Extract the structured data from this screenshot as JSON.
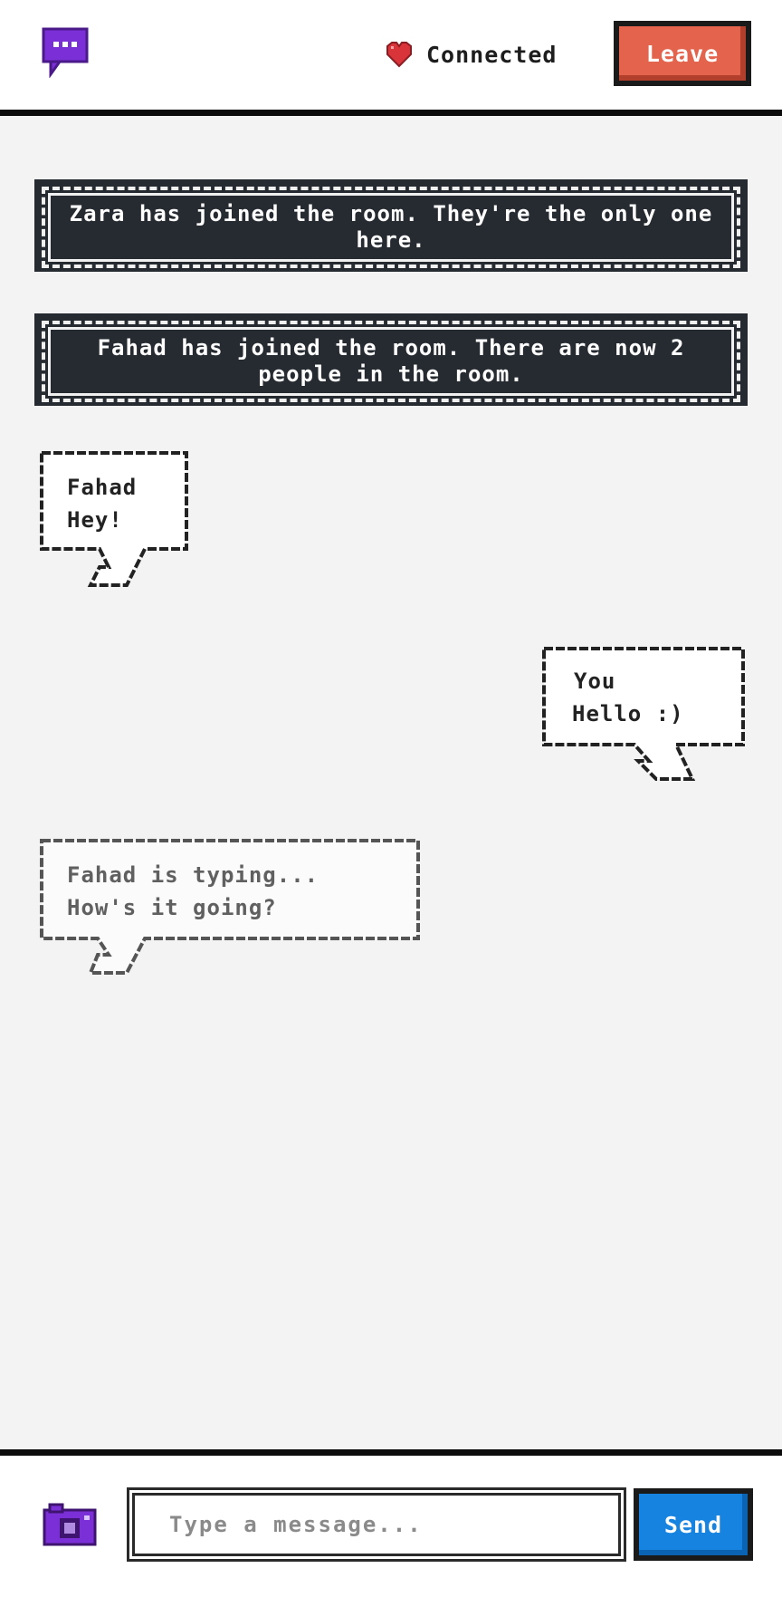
{
  "header": {
    "app_icon": "chat-bubble-icon",
    "status_icon": "heart-icon",
    "status_text": "Connected",
    "leave_label": "Leave"
  },
  "system_messages": [
    "Zara has joined the room. They're the only one here.",
    "Fahad has joined the room. There are now 2 people in the room."
  ],
  "messages": [
    {
      "author": "Fahad",
      "text": "Hey!"
    },
    {
      "author": "You",
      "text": "Hello :)"
    }
  ],
  "typing": {
    "status": "Fahad is typing...",
    "preview": "How's it going?"
  },
  "composer": {
    "camera_icon": "camera-icon",
    "placeholder": "Type a message...",
    "value": "",
    "send_label": "Send"
  },
  "colors": {
    "accent_purple": "#7b2fd6",
    "leave_red": "#e3634c",
    "send_blue": "#1783e0",
    "heart_red": "#d9343a"
  }
}
